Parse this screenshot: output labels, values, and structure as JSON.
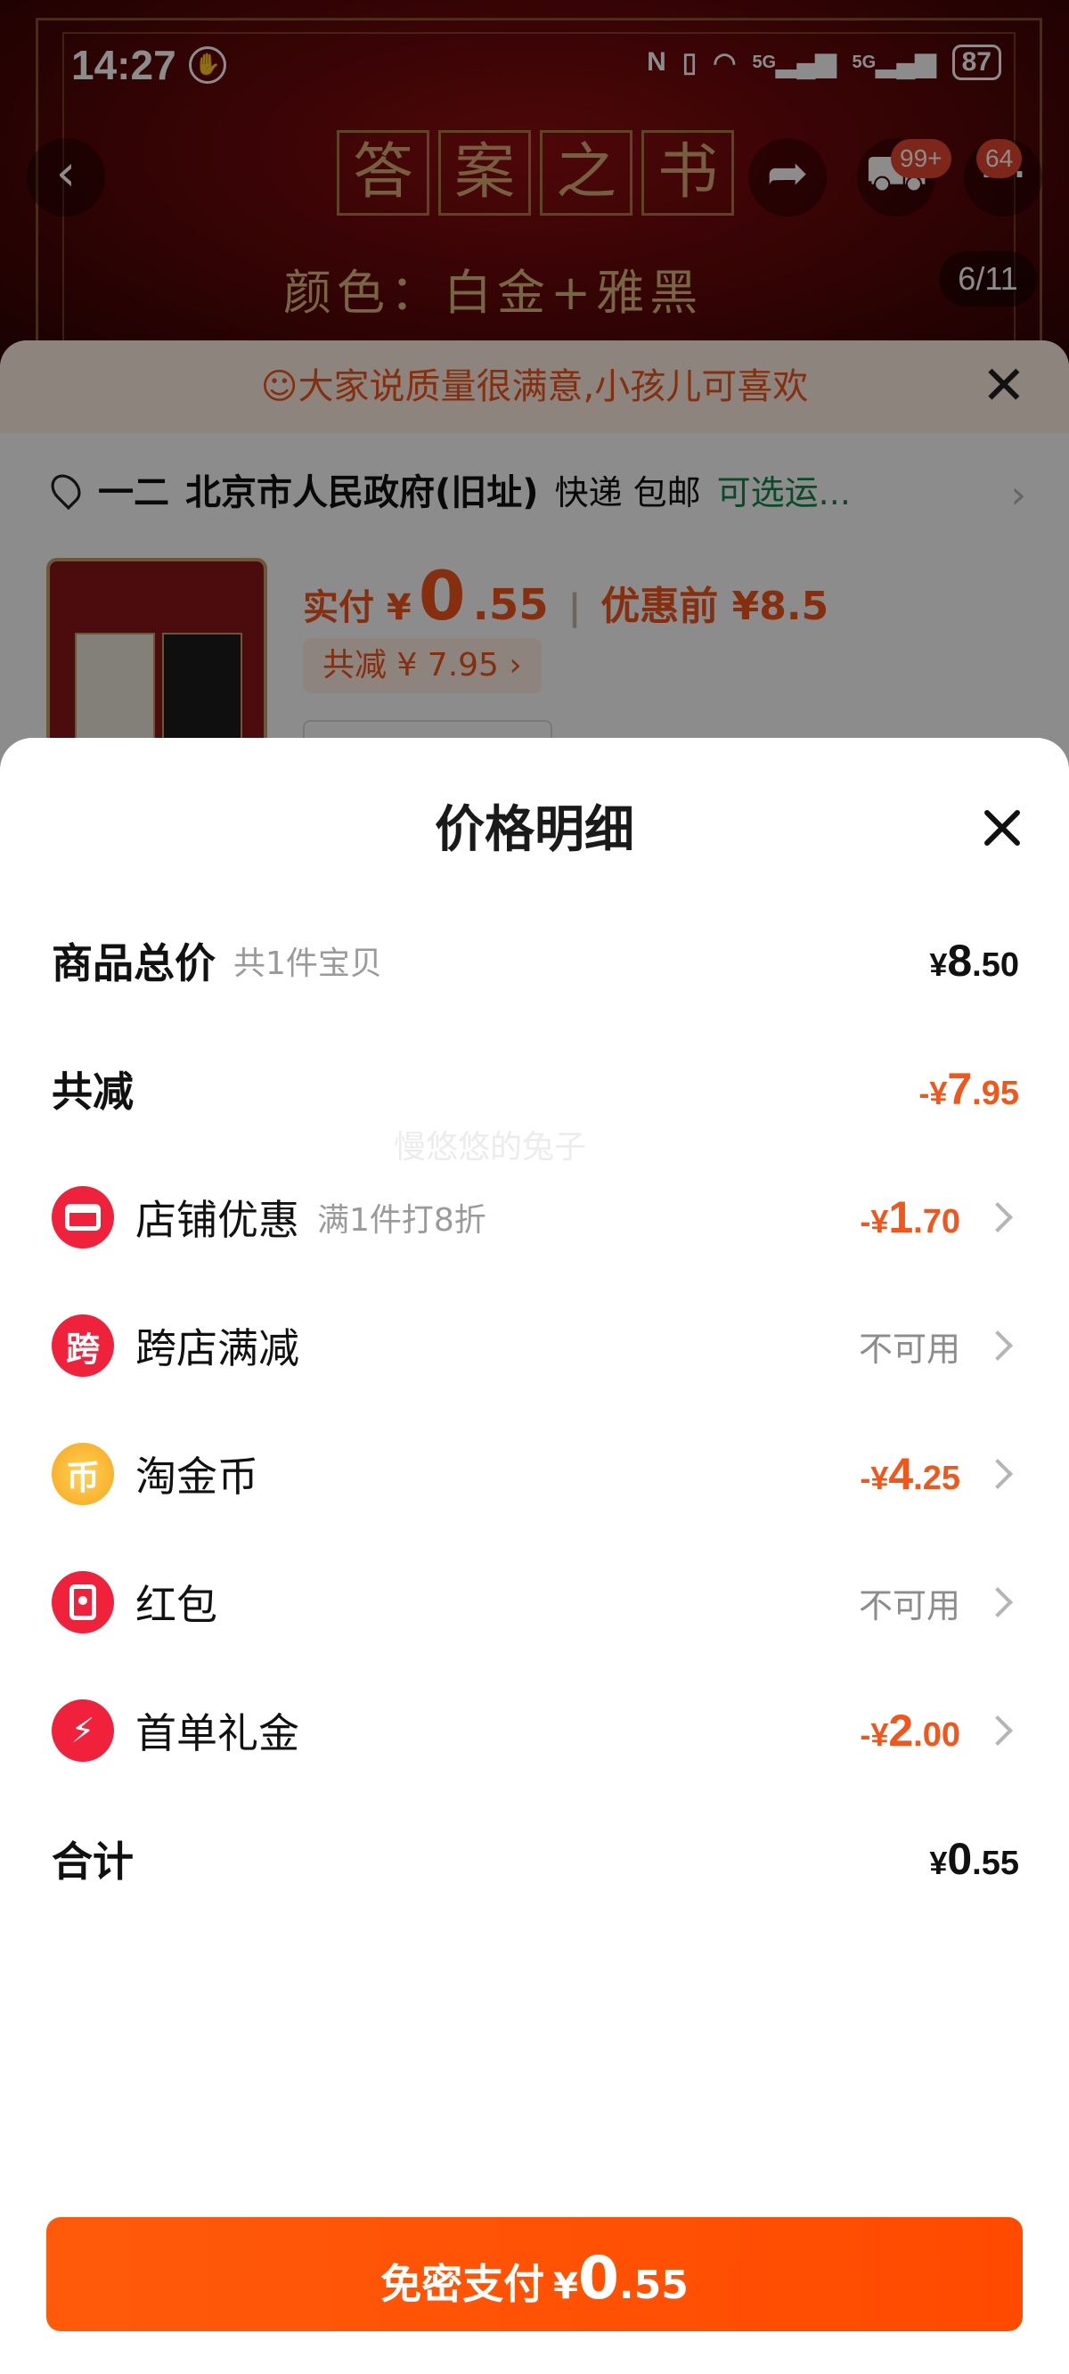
{
  "status_bar": {
    "time": "14:27",
    "signal1": "5G",
    "signal2": "5G",
    "battery": "87"
  },
  "background": {
    "badge_cart": "99+",
    "badge_more": "64",
    "book_title_chars": [
      "答",
      "案",
      "之",
      "书"
    ],
    "color_label": "颜色：白金+雅黑",
    "page_counter": "6/11",
    "banner": "大家说质量很满意,小孩儿可喜欢",
    "address": {
      "name": "一二",
      "location": "北京市人民政府(旧址)",
      "delivery": "快递 包邮",
      "option": "可选运..."
    },
    "price": {
      "label": "实付 ¥",
      "int": "0",
      "dec": ".55",
      "before": "优惠前 ¥8.5",
      "discount": "共减 ¥ 7.95 ›"
    }
  },
  "sheet": {
    "title": "价格明细",
    "watermark": "慢悠悠的兔子",
    "rows": {
      "total": {
        "label": "商品总价",
        "sub": "共1件宝贝",
        "sym": "¥",
        "int": "8",
        "dec": ".50"
      },
      "reduce": {
        "label": "共减",
        "sym": "-¥",
        "int": "7",
        "dec": ".95"
      },
      "shop": {
        "label": "店铺优惠",
        "sub": "满1件打8折",
        "sym": "-¥",
        "int": "1",
        "dec": ".70"
      },
      "cross": {
        "label": "跨店满减",
        "icon_char": "跨",
        "status": "不可用"
      },
      "coin": {
        "label": "淘金币",
        "icon_char": "币",
        "sym": "-¥",
        "int": "4",
        "dec": ".25"
      },
      "redpacket": {
        "label": "红包",
        "status": "不可用"
      },
      "firstorder": {
        "label": "首单礼金",
        "icon_char": "⚡",
        "sym": "-¥",
        "int": "2",
        "dec": ".00"
      },
      "sum": {
        "label": "合计",
        "sym": "¥",
        "int": "0",
        "dec": ".55"
      }
    },
    "pay_button": {
      "label": "免密支付",
      "sym": "¥",
      "int": "0",
      "dec": ".55"
    }
  },
  "colors": {
    "accent": "#f2561b",
    "button": "#ff5000",
    "icon_red": "#f0213a",
    "icon_gold": "#f7a51a"
  }
}
